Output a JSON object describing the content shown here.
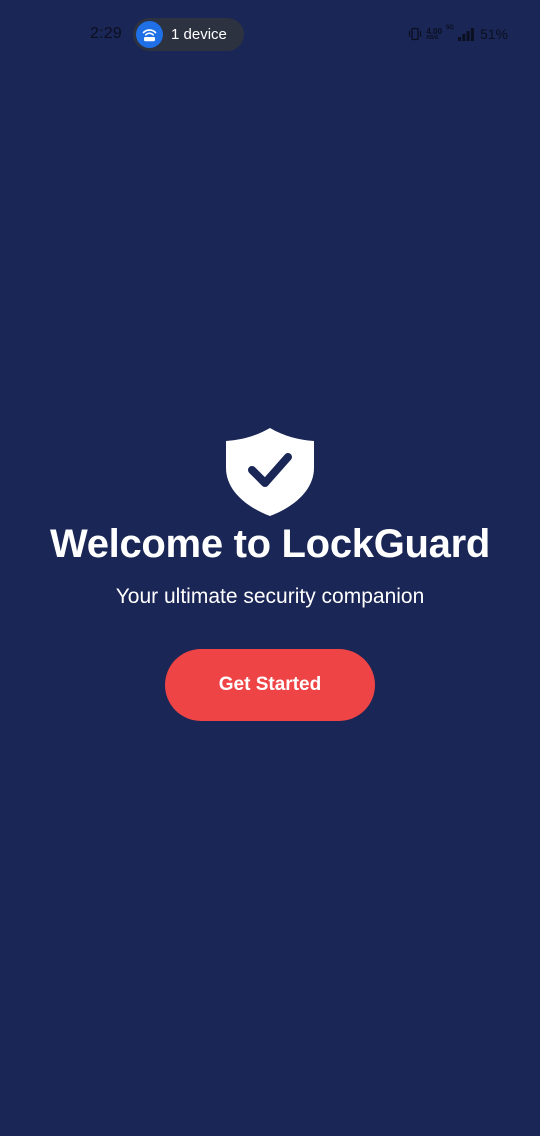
{
  "status_bar": {
    "time": "2:29",
    "hotspot_label": "1 device",
    "hotspot_icon": "wifi-router-icon",
    "net_speed_value": "4.00",
    "net_speed_unit": "KB/S",
    "net_type": "5G",
    "battery": "51%"
  },
  "welcome": {
    "icon": "shield-check-icon",
    "title": "Welcome to LockGuard",
    "subtitle": "Your ultimate security companion",
    "button_label": "Get Started"
  },
  "colors": {
    "background": "#1a2655",
    "button": "#ef4446",
    "hotspot_pill": "#2c3240",
    "hotspot_icon_bg": "#1f6fe6"
  }
}
